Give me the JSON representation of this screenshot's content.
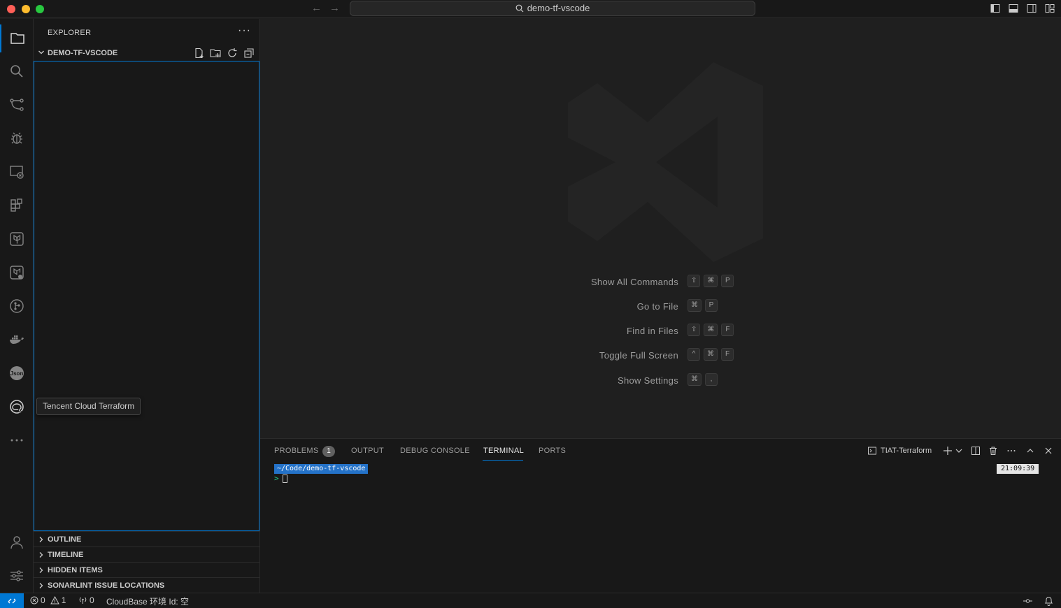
{
  "window": {
    "search_text": "demo-tf-vscode",
    "back_icon": "arrow-left-icon",
    "forward_icon": "arrow-right-icon"
  },
  "activity_bar": {
    "items": [
      "explorer-icon",
      "search-icon",
      "source-control-icon",
      "run-debug-icon",
      "remote-explorer-icon",
      "extensions-icon",
      "terraform-icon",
      "terraform-cloud-icon",
      "git-graph-icon",
      "docker-icon",
      "json-icon",
      "tencent-cloud-icon",
      "more-icon"
    ],
    "bottom": [
      "accounts-icon",
      "manage-icon"
    ]
  },
  "sidebar": {
    "title": "EXPLORER",
    "more": "···",
    "folder": "DEMO-TF-VSCODE",
    "sections": [
      {
        "label": "OUTLINE"
      },
      {
        "label": "TIMELINE"
      },
      {
        "label": "HIDDEN ITEMS"
      },
      {
        "label": "SONARLINT ISSUE LOCATIONS"
      }
    ]
  },
  "tooltip": {
    "text": "Tencent Cloud Terraform"
  },
  "editor": {
    "shortcuts": [
      {
        "label": "Show All Commands",
        "keys": [
          "⇧",
          "⌘",
          "P"
        ]
      },
      {
        "label": "Go to File",
        "keys": [
          "⌘",
          "P"
        ]
      },
      {
        "label": "Find in Files",
        "keys": [
          "⇧",
          "⌘",
          "F"
        ]
      },
      {
        "label": "Toggle Full Screen",
        "keys": [
          "^",
          "⌘",
          "F"
        ]
      },
      {
        "label": "Show Settings",
        "keys": [
          "⌘",
          ","
        ]
      }
    ]
  },
  "panel": {
    "tabs": {
      "problems": "PROBLEMS",
      "problems_count": "1",
      "output": "OUTPUT",
      "debug_console": "DEBUG CONSOLE",
      "terminal": "TERMINAL",
      "ports": "PORTS"
    },
    "terminal_name": "TIAT-Terraform",
    "terminal": {
      "path": "~/Code/demo-tf-vscode",
      "prompt": ">",
      "time": "21:09:39"
    }
  },
  "statusbar": {
    "errors": "0",
    "warnings": "1",
    "ports": "0",
    "cloudbase": "CloudBase 环境 Id: 空"
  },
  "colors": {
    "accent": "#0078d4",
    "background": "#1f1f1f",
    "sidebar": "#181818"
  }
}
